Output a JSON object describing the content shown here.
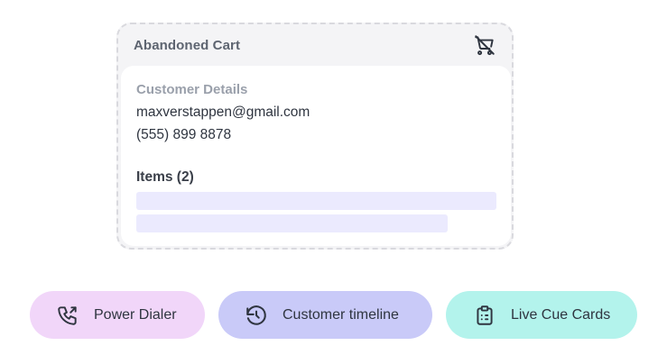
{
  "cart": {
    "title": "Abandoned Cart",
    "icon": "cart-off-icon",
    "details_label": "Customer Details",
    "email": "maxverstappen@gmail.com",
    "phone": "(555) 899 8878",
    "items_label": "Items (2)"
  },
  "actions": [
    {
      "label": "Power Dialer",
      "icon": "phone-outgoing-icon",
      "color": "#f1d6f9"
    },
    {
      "label": "Customer timeline",
      "icon": "history-icon",
      "color": "#c9caf8"
    },
    {
      "label": "Live Cue Cards",
      "icon": "clipboard-list-icon",
      "color": "#b3f3ec"
    }
  ],
  "colors": {
    "card_bg": "#f4f4f6",
    "item_placeholder": "#ebeafe",
    "text_dark": "#2f3540",
    "text_muted": "#9aa0ab"
  }
}
